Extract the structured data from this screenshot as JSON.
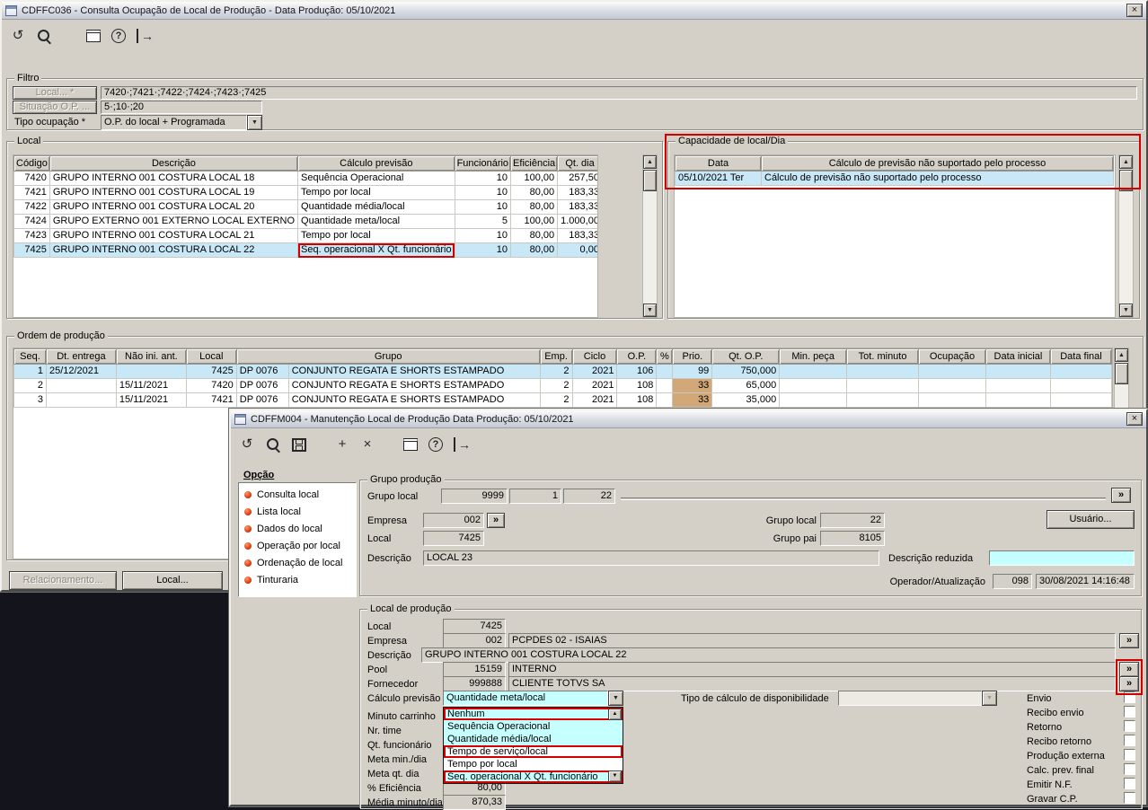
{
  "colors": {
    "window_bg": "#d4d0c8",
    "selection": "#c9e8f7",
    "field_cyan": "#c5ffff",
    "prio_high": "#e6c89b",
    "prio_low": "#d2a878",
    "annotation_red": "#d40000",
    "desktop_dark": "#14141d"
  },
  "icons": {
    "undo": "↺",
    "plus": "+",
    "delete": "×",
    "help": "?",
    "exit": "→",
    "close": "×",
    "up": "▲",
    "down": "▼",
    "zoom": "»"
  },
  "main": {
    "title": "CDFFC036 - Consulta Ocupação de Local de Produção - Data Produção: 05/10/2021",
    "filtro": {
      "legend": "Filtro",
      "local_button": "Local... *",
      "local_value": "7420·;7421·;7422·;7424·;7423·;7425",
      "situacao_button": "Situação O.P. ...",
      "situacao_value": "5·;10·;20",
      "tipo_label": "Tipo ocupação *",
      "tipo_value": "O.P. do local + Programada"
    },
    "local": {
      "legend": "Local",
      "headers": [
        "Código",
        "Descrição",
        "Cálculo previsão",
        "Funcionário",
        "Eficiência",
        "Qt. dia"
      ],
      "rows": [
        [
          "7420",
          "GRUPO INTERNO 001 COSTURA LOCAL 18",
          "Sequência Operacional",
          "10",
          "100,00",
          "257,50"
        ],
        [
          "7421",
          "GRUPO INTERNO 001 COSTURA LOCAL 19",
          "Tempo por local",
          "10",
          "80,00",
          "183,33"
        ],
        [
          "7422",
          "GRUPO INTERNO 001 COSTURA LOCAL 20",
          "Quantidade média/local",
          "10",
          "80,00",
          "183,33"
        ],
        [
          "7424",
          "GRUPO EXTERNO 001 EXTERNO LOCAL EXTERNO",
          "Quantidade meta/local",
          "5",
          "100,00",
          "1.000,00"
        ],
        [
          "7423",
          "GRUPO INTERNO 001 COSTURA LOCAL 21",
          "Tempo por local",
          "10",
          "80,00",
          "183,33"
        ],
        [
          "7425",
          "GRUPO INTERNO 001 COSTURA LOCAL 22",
          "Seq. operacional X Qt. funcionário",
          "10",
          "80,00",
          "0,00"
        ]
      ]
    },
    "capacidade": {
      "legend": "Capacidade de local/Dia",
      "headers": [
        "Data",
        "Cálculo de previsão não suportado pelo processo"
      ],
      "rows": [
        [
          "05/10/2021 Ter",
          "Cálculo de previsão não suportado pelo processo"
        ]
      ]
    },
    "ordem": {
      "legend": "Ordem de produção",
      "headers": [
        "Seq.",
        "Dt. entrega",
        "Não ini. ant.",
        "Local",
        "Grupo",
        "Emp.",
        "Ciclo",
        "O.P.",
        "%",
        "Prio.",
        "Qt. O.P.",
        "Min. peça",
        "Tot. minuto",
        "Ocupação",
        "Data inicial",
        "Data final"
      ],
      "rows": [
        [
          "1",
          "25/12/2021",
          "",
          "7425",
          "DP 0076",
          "CONJUNTO REGATA E SHORTS ESTAMPADO",
          "2",
          "2021",
          "106",
          "",
          "99",
          "750,000",
          "",
          "",
          "",
          "",
          ""
        ],
        [
          "2",
          "",
          "15/11/2021",
          "7420",
          "DP 0076",
          "CONJUNTO REGATA E SHORTS ESTAMPADO",
          "2",
          "2021",
          "108",
          "",
          "33",
          "65,000",
          "",
          "",
          "",
          "",
          ""
        ],
        [
          "3",
          "",
          "15/11/2021",
          "7421",
          "DP 0076",
          "CONJUNTO REGATA E SHORTS ESTAMPADO",
          "2",
          "2021",
          "108",
          "",
          "33",
          "35,000",
          "",
          "",
          "",
          "",
          ""
        ]
      ]
    },
    "relacionamento_button": "Relacionamento...",
    "local_button": "Local..."
  },
  "dialog": {
    "title": "CDFFM004 - Manutenção Local de Produção Data Produção: 05/10/2021",
    "opcao": {
      "legend": "Opção",
      "items": [
        "Consulta local",
        "Lista local",
        "Dados do local",
        "Operação por local",
        "Ordenação de local",
        "Tinturaria"
      ]
    },
    "grupo": {
      "legend": "Grupo produção",
      "grupo_local_label": "Grupo local",
      "grupo_local_v1": "9999",
      "grupo_local_v2": "1",
      "grupo_local_v3": "22",
      "empresa_label": "Empresa",
      "empresa_value": "002",
      "local_label": "Local",
      "local_value": "7425",
      "grupo_local2_label": "Grupo local",
      "grupo_local2_value": "22",
      "grupo_pai_label": "Grupo pai",
      "grupo_pai_value": "8105",
      "descricao_label": "Descrição",
      "descricao_value": "LOCAL 23",
      "descricao_reduzida_label": "Descrição reduzida",
      "descricao_reduzida_value": "",
      "usuario_button": "Usuário...",
      "operador_label": "Operador/Atualização",
      "operador_value": "098",
      "atualizacao_value": "30/08/2021 14:16:48"
    },
    "localprod": {
      "legend": "Local de produção",
      "local_label": "Local",
      "local_value": "7425",
      "empresa_label": "Empresa",
      "empresa_value": "002",
      "empresa_desc": "PCPDES 02 - ISAIAS",
      "descricao_label": "Descrição",
      "descricao_value": "GRUPO INTERNO 001 COSTURA LOCAL 22",
      "pool_label": "Pool",
      "pool_value": "15159",
      "pool_desc": "INTERNO",
      "fornecedor_label": "Fornecedor",
      "fornecedor_value": "999888",
      "fornecedor_desc": "CLIENTE TOTVS SA",
      "calculo_label": "Cálculo previsão",
      "calculo_value": "Quantidade meta/local",
      "dropdown_items": [
        "Nenhum",
        "Sequência Operacional",
        "Quantidade média/local",
        "Tempo de serviço/local",
        "Tempo por local",
        "Seq. operacional X Qt. funcionário"
      ],
      "minuto_carrinho_label": "Minuto carrinho",
      "nr_time_label": "Nr. time",
      "qt_funcionario_label": "Qt. funcionário",
      "meta_min_label": "Meta min./dia",
      "meta_qt_label": "Meta qt. dia",
      "eficiencia_label": "% Eficiência",
      "eficiencia_value": "80,00",
      "media_label": "Média minuto/dia",
      "media_value": "870,33",
      "tipo_calc_label": "Tipo de cálculo de disponibilidade",
      "tipo_calc_value": "",
      "checkboxes": [
        "Envio",
        "Recibo envio",
        "Retorno",
        "Recibo retorno",
        "Produção externa",
        "Calc. prev. final",
        "Emitir N.F.",
        "Gravar C.P."
      ]
    }
  }
}
